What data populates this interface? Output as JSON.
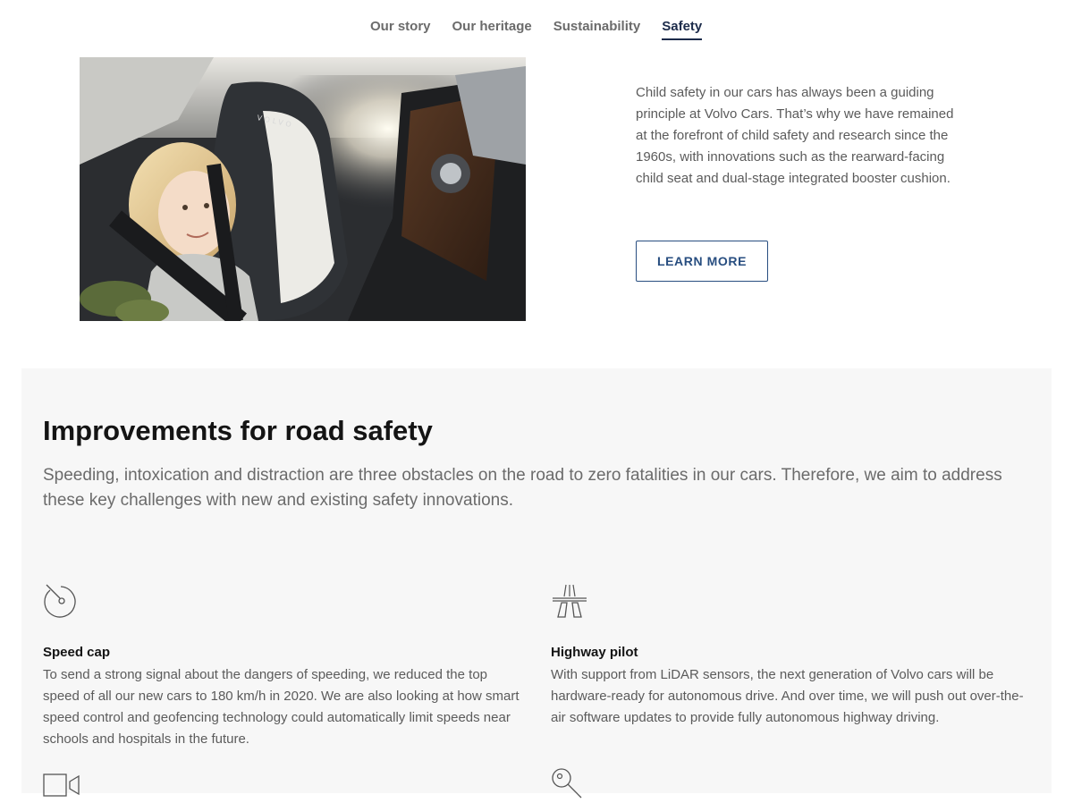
{
  "nav": {
    "items": [
      {
        "label": "Our story"
      },
      {
        "label": "Our heritage"
      },
      {
        "label": "Sustainability"
      },
      {
        "label": "Safety"
      }
    ],
    "active_index": 3
  },
  "hero": {
    "photo_alt": "Child seated in a Volvo child seat",
    "seat_brand": "VOLVO",
    "body": "Child safety in our cars has always been a guiding principle at Volvo Cars. That’s why we have remained at the forefront of child safety and research since the 1960s, with innovations such as the rearward-facing child seat and dual-stage integrated booster cushion.",
    "button_label": "LEARN MORE"
  },
  "improvements": {
    "title": "Improvements for road safety",
    "lead": "Speeding, intoxication and distraction are three obstacles on the road to zero fatalities in our cars. Therefore, we aim to address these key challenges with new and existing safety innovations.",
    "features": [
      {
        "icon": "speedometer-icon",
        "title": "Speed cap",
        "text": "To send a strong signal about the dangers of speeding, we reduced the top speed of all our new cars to 180 km/h in 2020. We are also looking at how smart speed control and geofencing technology could automatically limit speeds near schools and hospitals in the future."
      },
      {
        "icon": "highway-icon",
        "title": "Highway pilot",
        "text": "With support from LiDAR sensors, the next generation of Volvo cars will be hardware-ready for autonomous drive. And over time, we will push out over-the-air software updates to provide fully autonomous highway driving."
      },
      {
        "icon": "camera-icon"
      },
      {
        "icon": "key-icon"
      }
    ]
  },
  "colors": {
    "accent": "#284e80",
    "nav_active": "#1c2b4a",
    "panel_bg": "#f7f7f7",
    "body_text": "#5b5b5b"
  }
}
